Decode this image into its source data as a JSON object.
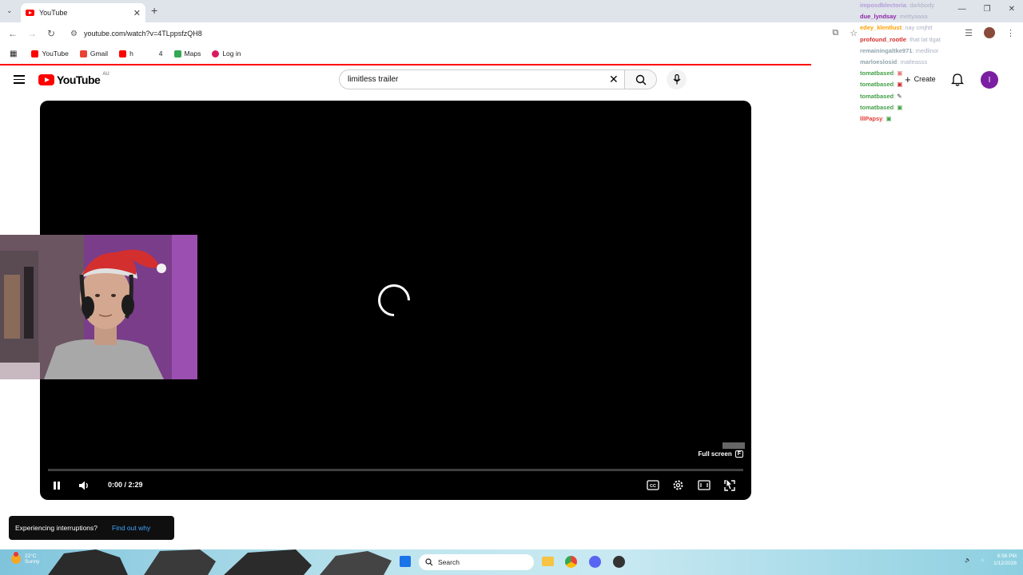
{
  "browser": {
    "tab_title": "YouTube",
    "url": "youtube.com/watch?v=4TLppsfzQH8",
    "bookmarks": [
      {
        "label": "YouTube",
        "color": "#ff0000"
      },
      {
        "label": "Gmail",
        "color": "#ea4335"
      },
      {
        "label": "h",
        "color": "#ff0000"
      },
      {
        "label": "4",
        "color": ""
      },
      {
        "label": "Maps",
        "color": "#34a853"
      },
      {
        "label": "Log in",
        "color": "#d81b60"
      }
    ]
  },
  "youtube": {
    "logo_text": "YouTube",
    "country_code": "AU",
    "search_query": "limitless trailer",
    "create_label": "Create",
    "avatar_letter": "I"
  },
  "chat": [
    {
      "user": "imposdblectoria",
      "msg": "darkbody",
      "color": "#b39ddb"
    },
    {
      "user": "due_lyndsay",
      "msg": "mettyaaaa",
      "color": "#8e24aa"
    },
    {
      "user": "edey_klentlust",
      "msg": "nay cmjhtt",
      "color": "#ffa000"
    },
    {
      "user": "profound_rootle",
      "msg": "that lat tlgat",
      "color": "#d32f2f"
    },
    {
      "user": "remainingaltke971",
      "msg": "medlinor",
      "color": "#90a4ae"
    },
    {
      "user": "marloeslosid",
      "msg": "matleasss",
      "color": "#90a4ae"
    },
    {
      "user": "tomatbased",
      "msg": "",
      "color": "#43a047"
    },
    {
      "user": "tomatbased",
      "msg": "",
      "color": "#43a047"
    },
    {
      "user": "tomatbased",
      "msg": "",
      "color": "#43a047"
    },
    {
      "user": "tomatbased",
      "msg": "",
      "color": "#43a047"
    },
    {
      "user": "lllPapsy",
      "msg": "",
      "color": "#e53935"
    }
  ],
  "player": {
    "time_current": "0:00",
    "time_sep": " / ",
    "time_total": "2:29",
    "fullscreen_tooltip": "Full screen",
    "fullscreen_key": "F",
    "progress": 0
  },
  "toast": {
    "message": "Experiencing interruptions?",
    "link": "Find out why"
  },
  "taskbar": {
    "temperature": "22°C",
    "weather": "Sunny",
    "search_placeholder": "Search",
    "time": "6:56 PM",
    "date": "1/12/2026"
  }
}
